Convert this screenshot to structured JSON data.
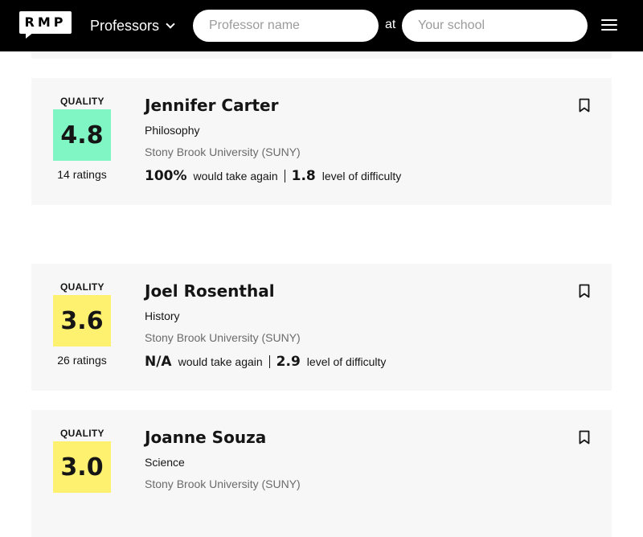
{
  "header": {
    "logo_text": "RMP",
    "nav_dropdown_label": "Professors",
    "professor_search_placeholder": "Professor name",
    "at_label": "at",
    "school_search_placeholder": "Your school"
  },
  "results": [
    {
      "quality_label": "QUALITY",
      "score": "4.8",
      "score_color": "#7ff6c3",
      "ratings": "14 ratings",
      "name": "Jennifer Carter",
      "department": "Philosophy",
      "school": "Stony Brook University (SUNY)",
      "would_take_again": "100%",
      "would_take_again_label": "would take again",
      "difficulty": "1.8",
      "difficulty_label": "level of difficulty"
    },
    {
      "quality_label": "QUALITY",
      "score": "3.6",
      "score_color": "#fff170",
      "ratings": "26 ratings",
      "name": "Joel Rosenthal",
      "department": "History",
      "school": "Stony Brook University (SUNY)",
      "would_take_again": "N/A",
      "would_take_again_label": "would take again",
      "difficulty": "2.9",
      "difficulty_label": "level of difficulty"
    },
    {
      "quality_label": "QUALITY",
      "score": "3.0",
      "score_color": "#fff170",
      "name": "Joanne Souza",
      "department": "Science",
      "school": "Stony Brook University (SUNY)"
    }
  ]
}
